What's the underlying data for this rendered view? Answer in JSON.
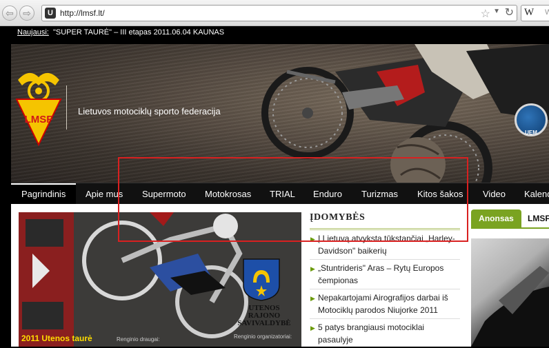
{
  "browser": {
    "back": "⇦",
    "forward": "⇨",
    "favicon_letter": "U",
    "url": "http://lmsf.lt/",
    "search_engine_letter": "W",
    "search_placeholder": "W"
  },
  "ticker": {
    "label": "Naujausi:",
    "text": "\"SUPER TAURĖ\" – III etapas 2011.06.04 KAUNAS"
  },
  "header": {
    "logo_text": "LMSF",
    "brand_name": "Lietuvos motociklų sporto federacija",
    "badge_text": "UEM"
  },
  "nav": {
    "items": [
      "Pagrindinis",
      "Apie mus",
      "Supermoto",
      "Motokrosas",
      "TRIAL",
      "Enduro",
      "Turizmas",
      "Kitos šakos",
      "Video",
      "Kalend"
    ]
  },
  "feature": {
    "caption": "2011 Utenos taurė",
    "sponsor_a": "Renginio draugai:",
    "sponsor_b": "Renginio organizatoriai:",
    "region_line1": "UTENOS",
    "region_line2": "RAJONO",
    "region_line3": "SAVIVALDYBĖ"
  },
  "news": {
    "title": "ĮDOMYBĖS",
    "items": [
      "Į Lietuvą atvyksta tūkstančiai „Harley-Davidson\" baikerių",
      "„Stuntrideris\" Aras – Rytų Europos čempionas",
      "Nepakartojami Airografijos darbai iš Motociklų parodos Niujorke 2011",
      "5 patys brangiausi motociklai pasaulyje"
    ]
  },
  "announce": {
    "tab_active": "Anonsas",
    "tab_other": "LMSF"
  },
  "colors": {
    "accent_green": "#7aa321",
    "logo_yellow": "#f5c400",
    "highlight_red": "#d92020"
  }
}
